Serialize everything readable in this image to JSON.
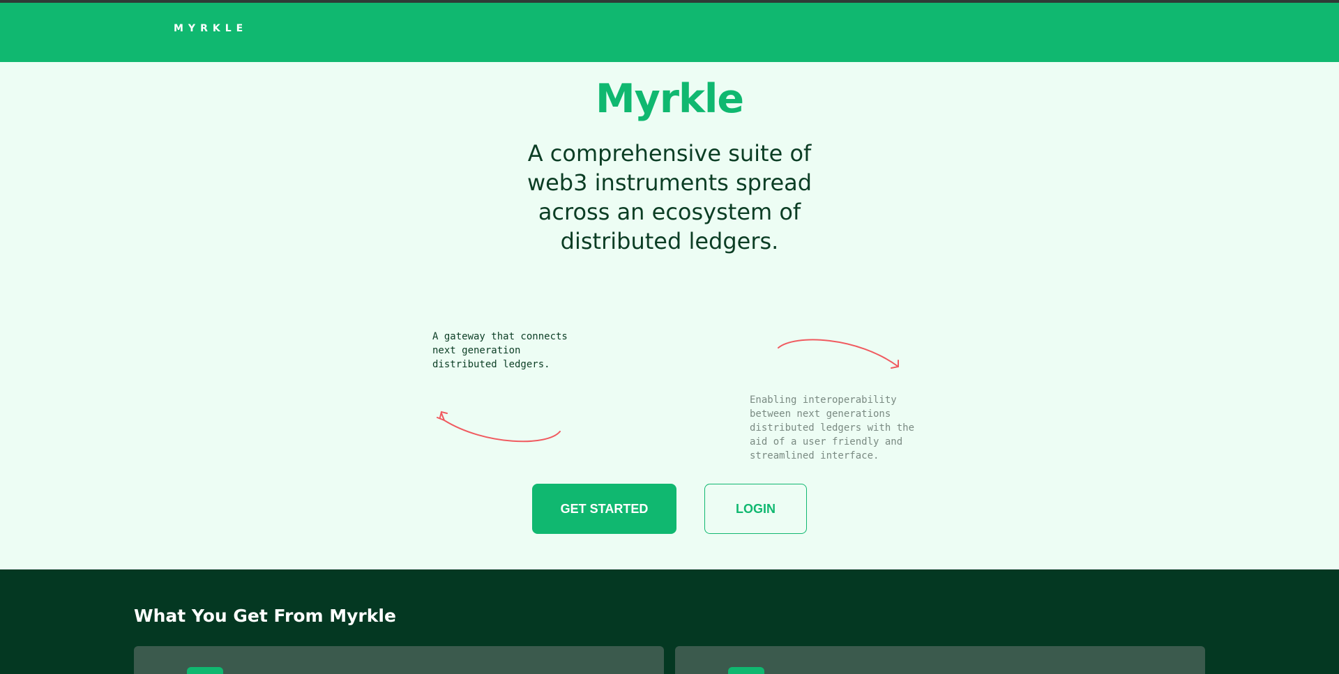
{
  "brand": {
    "logo_text": "MYRKLE"
  },
  "hero": {
    "title": "Myrkle",
    "subtitle": "A comprehensive suite of web3 instruments spread across an ecosystem of distributed ledgers.",
    "note_left": "A gateway that connects next generation distributed ledgers.",
    "note_right": "Enabling interoperability between next generations distributed ledgers with the aid of a user friendly and streamlined interface.",
    "get_started_label": "GET STARTED",
    "login_label": "LOGIN"
  },
  "features": {
    "heading": "What You Get From Myrkle"
  },
  "colors": {
    "accent": "#10b870",
    "hero_bg": "#edfdf4",
    "dark_bg": "#043822",
    "card_bg": "#3b5a4d",
    "arrow": "#f05a5f"
  }
}
